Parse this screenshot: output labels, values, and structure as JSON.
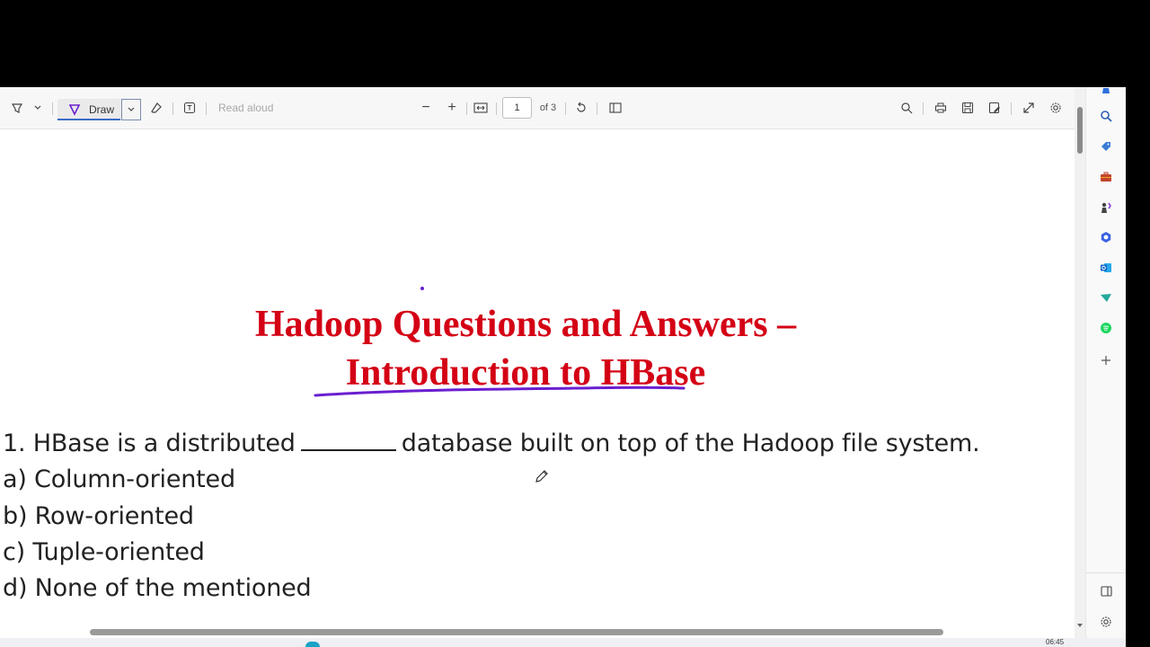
{
  "toolbar": {
    "draw_label": "Draw",
    "read_aloud_label": "Read aloud",
    "page_number": "1",
    "page_total": "of 3",
    "zoom_out": "−",
    "zoom_in": "+"
  },
  "document": {
    "title_line1": "Hadoop Questions and Answers –",
    "title_line2": "Introduction to HBase",
    "question1_before": "1. HBase is a distributed",
    "question1_after": "database built on top of the Hadoop file system.",
    "options": [
      "a) Column-oriented",
      "b) Row-oriented",
      "c) Tuple-oriented",
      "d) None of the mentioned"
    ]
  },
  "colors": {
    "title": "#d40015",
    "ink_annotation": "#6a1fd0",
    "toolbar_bg": "#f7f7f7"
  },
  "sidebar": {
    "icons": [
      "bell-icon",
      "search-icon",
      "tag-icon",
      "briefcase-icon",
      "chess-icon",
      "copilot-icon",
      "outlook-icon",
      "send-icon",
      "spotify-icon",
      "add-icon",
      "split-view-icon",
      "settings-icon"
    ]
  },
  "taskbar": {
    "time": "06:45"
  }
}
